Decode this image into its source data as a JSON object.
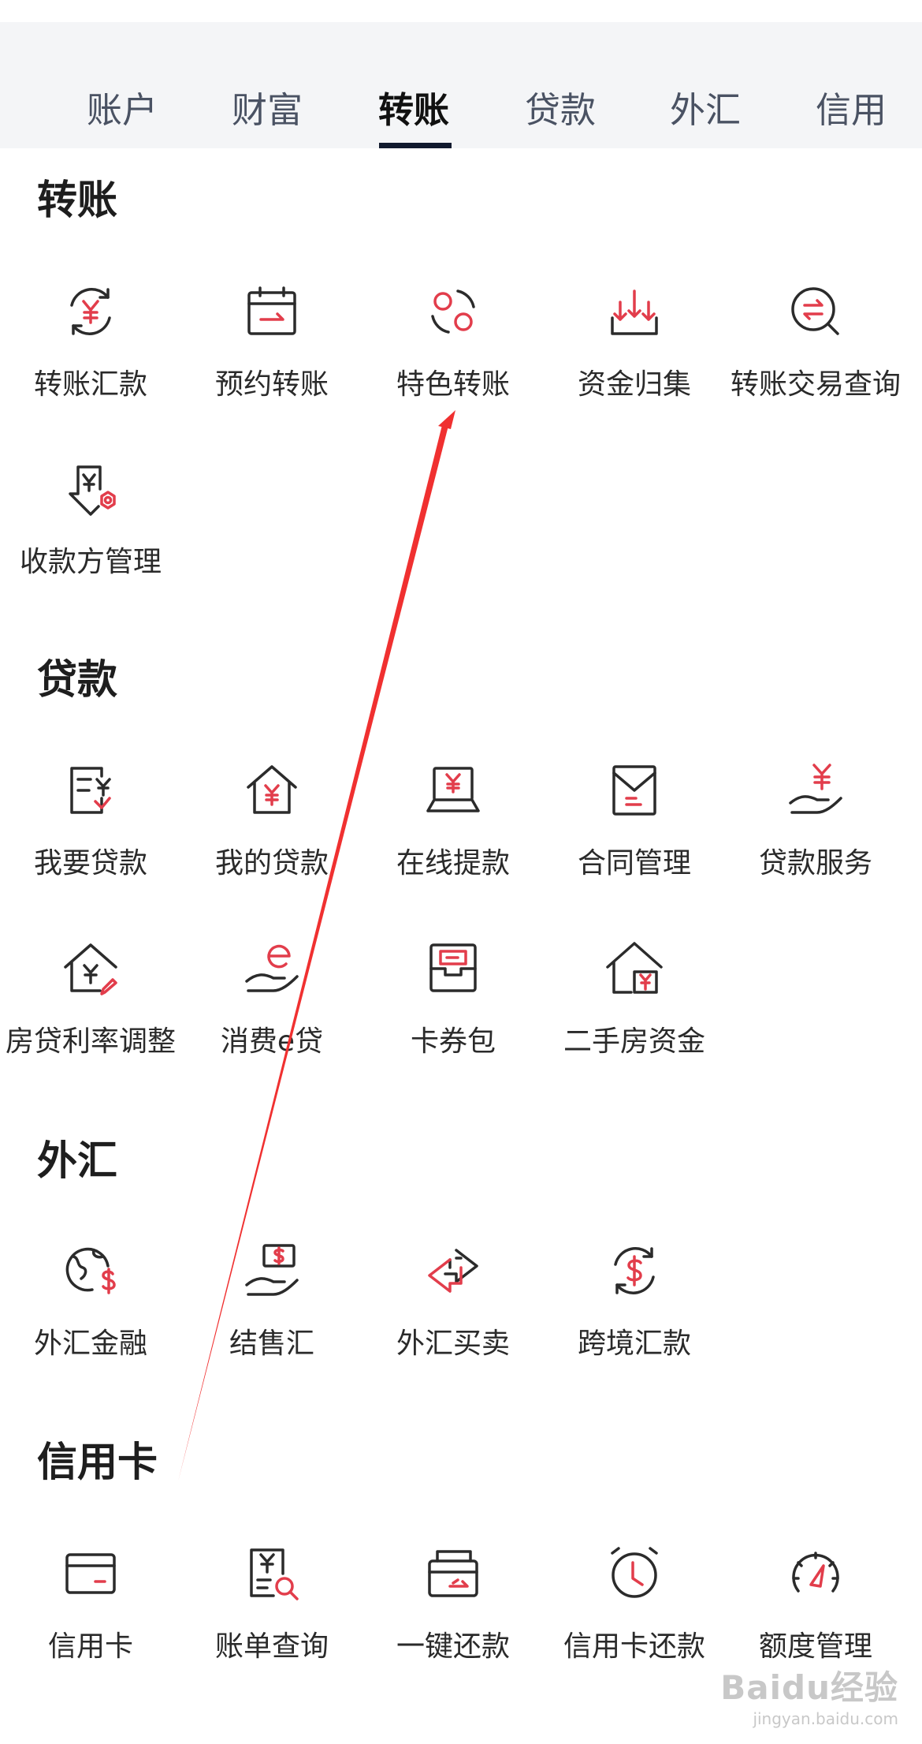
{
  "tabs": [
    "账户",
    "财富",
    "转账",
    "贷款",
    "外汇",
    "信用"
  ],
  "active_tab": "转账",
  "colors": {
    "accent": "#e23d4b",
    "icon_stroke": "#2b2b2b",
    "tab_bg": "#f4f5f7",
    "underline": "#111a2e"
  },
  "sections": {
    "transfer": {
      "title": "转账",
      "items": [
        {
          "label": "转账汇款",
          "icon": "yuan-refresh-icon"
        },
        {
          "label": "预约转账",
          "icon": "calendar-transfer-icon"
        },
        {
          "label": "特色转账",
          "icon": "circles-exchange-icon"
        },
        {
          "label": "资金归集",
          "icon": "funds-collect-icon"
        },
        {
          "label": "转账交易查询",
          "icon": "transfer-search-icon"
        },
        {
          "label": "收款方管理",
          "icon": "payee-manage-icon"
        }
      ]
    },
    "loan": {
      "title": "贷款",
      "items": [
        {
          "label": "我要贷款",
          "icon": "loan-apply-icon"
        },
        {
          "label": "我的贷款",
          "icon": "house-yuan-icon"
        },
        {
          "label": "在线提款",
          "icon": "laptop-yuan-icon"
        },
        {
          "label": "合同管理",
          "icon": "contract-envelope-icon"
        },
        {
          "label": "贷款服务",
          "icon": "hand-yuan-icon"
        },
        {
          "label": "房贷利率调整",
          "icon": "house-edit-icon"
        },
        {
          "label": "消费e贷",
          "icon": "hand-e-icon"
        },
        {
          "label": "卡券包",
          "icon": "coupon-wallet-icon"
        },
        {
          "label": "二手房资金",
          "icon": "house-funds-icon"
        }
      ]
    },
    "forex": {
      "title": "外汇",
      "items": [
        {
          "label": "外汇金融",
          "icon": "globe-dollar-icon"
        },
        {
          "label": "结售汇",
          "icon": "hand-dollar-icon"
        },
        {
          "label": "外汇买卖",
          "icon": "exchange-arrows-icon"
        },
        {
          "label": "跨境汇款",
          "icon": "dollar-refresh-icon"
        }
      ]
    },
    "credit": {
      "title": "信用卡",
      "items": [
        {
          "label": "信用卡",
          "icon": "credit-card-icon"
        },
        {
          "label": "账单查询",
          "icon": "bill-search-icon"
        },
        {
          "label": "一键还款",
          "icon": "card-repay-icon"
        },
        {
          "label": "信用卡还款",
          "icon": "alarm-clock-icon"
        },
        {
          "label": "额度管理",
          "icon": "gauge-icon"
        }
      ]
    }
  },
  "watermark": {
    "main": "Baidu经验",
    "sub": "jingyan.baidu.com"
  }
}
